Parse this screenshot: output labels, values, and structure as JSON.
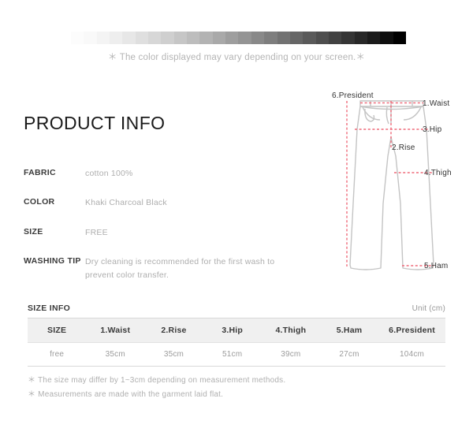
{
  "color_strip": {
    "disclaimer": "＊ The color displayed may vary depending on your screen.＊",
    "gradient_from": "#fcfcfc",
    "gradient_to": "#000000",
    "steps": 26
  },
  "product_info": {
    "title": "PRODUCT INFO",
    "specs": [
      {
        "label": "FABRIC",
        "value": "cotton 100%"
      },
      {
        "label": "COLOR",
        "value": "Khaki Charcoal Black"
      },
      {
        "label": "SIZE",
        "value": "FREE"
      },
      {
        "label": "WASHING TIP",
        "value": "Dry cleaning is recommended for the first wash to prevent color transfer."
      }
    ]
  },
  "diagram": {
    "outline_color": "#c4c4c4",
    "measure_color": "#ef6b7a",
    "labels": {
      "president": "6.President",
      "waist": "1.Waist",
      "hip": "3.Hip",
      "rise": "2.Rise",
      "thigh": "4.Thigh",
      "ham": "5.Ham"
    }
  },
  "size_info": {
    "title": "SIZE INFO",
    "unit": "Unit (cm)",
    "columns": [
      "SIZE",
      "1.Waist",
      "2.Rise",
      "3.Hip",
      "4.Thigh",
      "5.Ham",
      "6.President"
    ],
    "rows": [
      [
        "free",
        "35cm",
        "35cm",
        "51cm",
        "39cm",
        "27cm",
        "104cm"
      ]
    ],
    "notes": [
      "＊ The size may differ by 1~3cm depending on measurement methods.",
      "＊ Measurements are made with the garment laid flat."
    ]
  }
}
